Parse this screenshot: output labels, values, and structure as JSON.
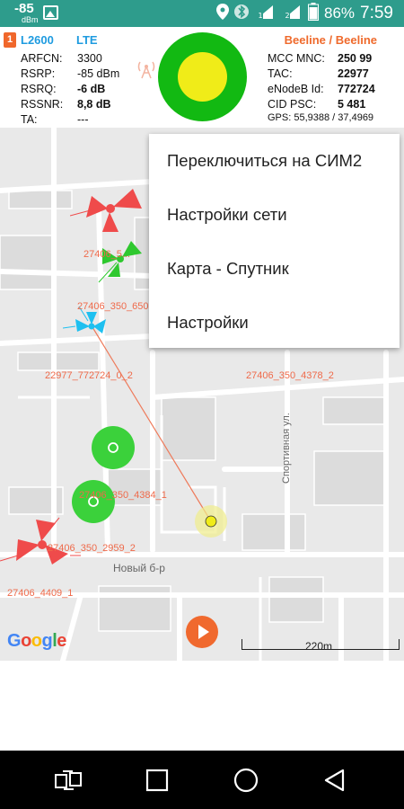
{
  "status_bar": {
    "signal_dbm": "-85",
    "signal_unit": "dBm",
    "battery_percent": "86%",
    "time": "7:59",
    "icons": [
      "image-icon",
      "location-icon",
      "bluetooth-icon",
      "sim1-signal-icon",
      "sim2-signal-icon",
      "battery-icon"
    ]
  },
  "cell_info": {
    "sim_slot": "1",
    "band": "L2600",
    "technology": "LTE",
    "operator": "Beeline / Beeline",
    "left": [
      {
        "label": "ARFCN:",
        "value": "3300"
      },
      {
        "label": "RSRP:",
        "value": "-85 dBm"
      },
      {
        "label": "RSRQ:",
        "value": "-6 dB"
      },
      {
        "label": "RSSNR:",
        "value": "8,8 dB"
      },
      {
        "label": "TA:",
        "value": "---"
      }
    ],
    "right": [
      {
        "label": "MCC MNC:",
        "value": "250 99"
      },
      {
        "label": "TAC:",
        "value": "22977"
      },
      {
        "label": "eNodeB Id:",
        "value": "772724"
      },
      {
        "label": "CID PSC:",
        "value": "5 481"
      }
    ],
    "gps_label": "GPS:",
    "gps_value": "55,9388 / 37,4969",
    "indicator_colors": {
      "outer": "#12b912",
      "inner": "#f0ec18"
    }
  },
  "map": {
    "cell_labels": [
      "27406_5...",
      "27406_350_650...",
      "22977_772724_0_2",
      "27406_350_4378_2",
      "27406_350_4384_1",
      "27406_350_2959_2",
      "27406_4409_1"
    ],
    "streets": {
      "new_boulevard": "Новый б-р",
      "sport_street": "Спортивная ул."
    },
    "google_letters": [
      "G",
      "o",
      "o",
      "g",
      "l",
      "e"
    ],
    "scale_label": "220m",
    "accent_color": "#ef6a2c"
  },
  "menu": {
    "items": [
      "Переключиться на СИМ2",
      "Настройки сети",
      "Карта - Спутник",
      "Настройки"
    ]
  },
  "nav_bar": {
    "icons": [
      "switch-sim-icon",
      "recents-square-icon",
      "home-circle-icon",
      "back-triangle-icon"
    ]
  }
}
